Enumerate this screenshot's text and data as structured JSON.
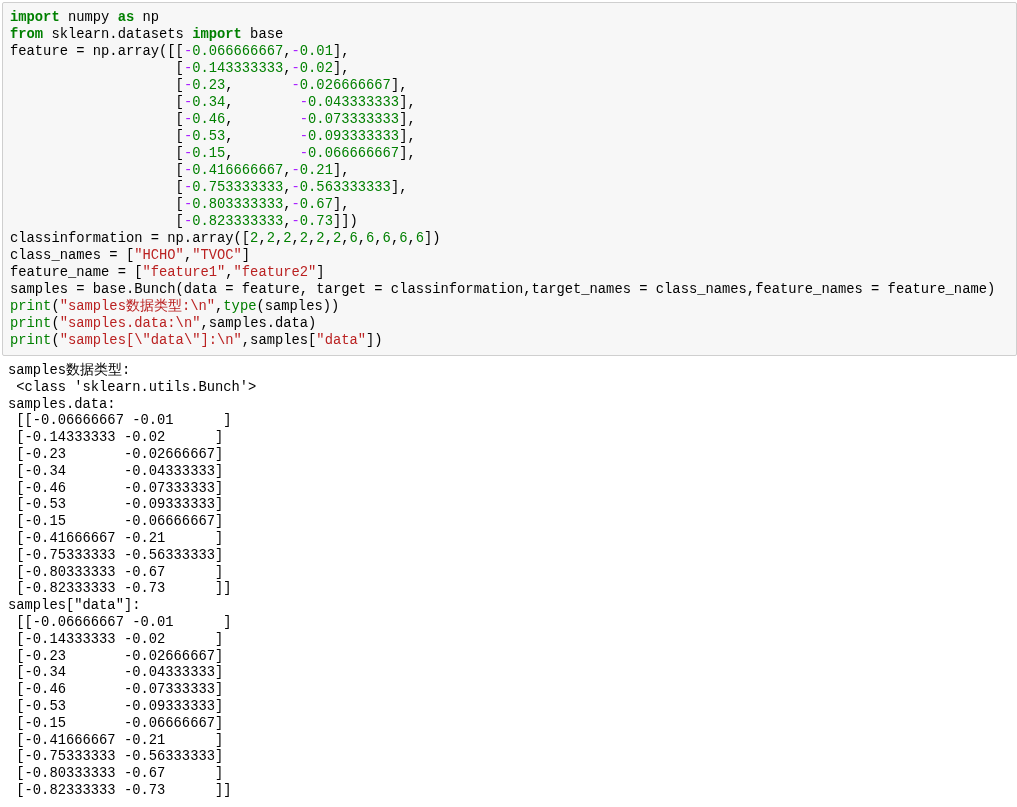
{
  "input_cell": {
    "lines": [
      [
        {
          "kind": "kw",
          "t": "import"
        },
        {
          "kind": "p",
          "t": " numpy "
        },
        {
          "kind": "kw",
          "t": "as"
        },
        {
          "kind": "p",
          "t": " np"
        }
      ],
      [
        {
          "kind": "kw",
          "t": "from"
        },
        {
          "kind": "p",
          "t": " sklearn.datasets "
        },
        {
          "kind": "kw",
          "t": "import"
        },
        {
          "kind": "p",
          "t": " base"
        }
      ],
      [
        {
          "kind": "p",
          "t": "feature = np.array([["
        },
        {
          "kind": "op",
          "t": "-"
        },
        {
          "kind": "num",
          "t": "0.066666667"
        },
        {
          "kind": "p",
          "t": ","
        },
        {
          "kind": "op",
          "t": "-"
        },
        {
          "kind": "num",
          "t": "0.01"
        },
        {
          "kind": "p",
          "t": "],"
        }
      ],
      [
        {
          "kind": "p",
          "t": "                    ["
        },
        {
          "kind": "op",
          "t": "-"
        },
        {
          "kind": "num",
          "t": "0.143333333"
        },
        {
          "kind": "p",
          "t": ","
        },
        {
          "kind": "op",
          "t": "-"
        },
        {
          "kind": "num",
          "t": "0.02"
        },
        {
          "kind": "p",
          "t": "],"
        }
      ],
      [
        {
          "kind": "p",
          "t": "                    ["
        },
        {
          "kind": "op",
          "t": "-"
        },
        {
          "kind": "num",
          "t": "0.23"
        },
        {
          "kind": "p",
          "t": ",       "
        },
        {
          "kind": "op",
          "t": "-"
        },
        {
          "kind": "num",
          "t": "0.026666667"
        },
        {
          "kind": "p",
          "t": "],"
        }
      ],
      [
        {
          "kind": "p",
          "t": "                    ["
        },
        {
          "kind": "op",
          "t": "-"
        },
        {
          "kind": "num",
          "t": "0.34"
        },
        {
          "kind": "p",
          "t": ",        "
        },
        {
          "kind": "op",
          "t": "-"
        },
        {
          "kind": "num",
          "t": "0.043333333"
        },
        {
          "kind": "p",
          "t": "],"
        }
      ],
      [
        {
          "kind": "p",
          "t": "                    ["
        },
        {
          "kind": "op",
          "t": "-"
        },
        {
          "kind": "num",
          "t": "0.46"
        },
        {
          "kind": "p",
          "t": ",        "
        },
        {
          "kind": "op",
          "t": "-"
        },
        {
          "kind": "num",
          "t": "0.073333333"
        },
        {
          "kind": "p",
          "t": "],"
        }
      ],
      [
        {
          "kind": "p",
          "t": "                    ["
        },
        {
          "kind": "op",
          "t": "-"
        },
        {
          "kind": "num",
          "t": "0.53"
        },
        {
          "kind": "p",
          "t": ",        "
        },
        {
          "kind": "op",
          "t": "-"
        },
        {
          "kind": "num",
          "t": "0.093333333"
        },
        {
          "kind": "p",
          "t": "],"
        }
      ],
      [
        {
          "kind": "p",
          "t": "                    ["
        },
        {
          "kind": "op",
          "t": "-"
        },
        {
          "kind": "num",
          "t": "0.15"
        },
        {
          "kind": "p",
          "t": ",        "
        },
        {
          "kind": "op",
          "t": "-"
        },
        {
          "kind": "num",
          "t": "0.066666667"
        },
        {
          "kind": "p",
          "t": "],"
        }
      ],
      [
        {
          "kind": "p",
          "t": "                    ["
        },
        {
          "kind": "op",
          "t": "-"
        },
        {
          "kind": "num",
          "t": "0.416666667"
        },
        {
          "kind": "p",
          "t": ","
        },
        {
          "kind": "op",
          "t": "-"
        },
        {
          "kind": "num",
          "t": "0.21"
        },
        {
          "kind": "p",
          "t": "],"
        }
      ],
      [
        {
          "kind": "p",
          "t": "                    ["
        },
        {
          "kind": "op",
          "t": "-"
        },
        {
          "kind": "num",
          "t": "0.753333333"
        },
        {
          "kind": "p",
          "t": ","
        },
        {
          "kind": "op",
          "t": "-"
        },
        {
          "kind": "num",
          "t": "0.563333333"
        },
        {
          "kind": "p",
          "t": "],"
        }
      ],
      [
        {
          "kind": "p",
          "t": "                    ["
        },
        {
          "kind": "op",
          "t": "-"
        },
        {
          "kind": "num",
          "t": "0.803333333"
        },
        {
          "kind": "p",
          "t": ","
        },
        {
          "kind": "op",
          "t": "-"
        },
        {
          "kind": "num",
          "t": "0.67"
        },
        {
          "kind": "p",
          "t": "],"
        }
      ],
      [
        {
          "kind": "p",
          "t": "                    ["
        },
        {
          "kind": "op",
          "t": "-"
        },
        {
          "kind": "num",
          "t": "0.823333333"
        },
        {
          "kind": "p",
          "t": ","
        },
        {
          "kind": "op",
          "t": "-"
        },
        {
          "kind": "num",
          "t": "0.73"
        },
        {
          "kind": "p",
          "t": "]])"
        }
      ],
      [
        {
          "kind": "p",
          "t": "classinformation = np.array(["
        },
        {
          "kind": "num",
          "t": "2"
        },
        {
          "kind": "p",
          "t": ","
        },
        {
          "kind": "num",
          "t": "2"
        },
        {
          "kind": "p",
          "t": ","
        },
        {
          "kind": "num",
          "t": "2"
        },
        {
          "kind": "p",
          "t": ","
        },
        {
          "kind": "num",
          "t": "2"
        },
        {
          "kind": "p",
          "t": ","
        },
        {
          "kind": "num",
          "t": "2"
        },
        {
          "kind": "p",
          "t": ","
        },
        {
          "kind": "num",
          "t": "2"
        },
        {
          "kind": "p",
          "t": ","
        },
        {
          "kind": "num",
          "t": "6"
        },
        {
          "kind": "p",
          "t": ","
        },
        {
          "kind": "num",
          "t": "6"
        },
        {
          "kind": "p",
          "t": ","
        },
        {
          "kind": "num",
          "t": "6"
        },
        {
          "kind": "p",
          "t": ","
        },
        {
          "kind": "num",
          "t": "6"
        },
        {
          "kind": "p",
          "t": ","
        },
        {
          "kind": "num",
          "t": "6"
        },
        {
          "kind": "p",
          "t": "])"
        }
      ],
      [
        {
          "kind": "p",
          "t": "class_names = ["
        },
        {
          "kind": "strc",
          "t": "\"HCHO\","
        },
        {
          "kind": "str",
          "t": "\"TVOC\""
        },
        {
          "kind": "p",
          "t": "]"
        }
      ],
      [
        {
          "kind": "p",
          "t": "feature_name = ["
        },
        {
          "kind": "strc",
          "t": "\"feature1\","
        },
        {
          "kind": "str",
          "t": "\"feature2\""
        },
        {
          "kind": "p",
          "t": "]"
        }
      ],
      [
        {
          "kind": "p",
          "t": "samples = base.Bunch(data = feature, target = classinformation,target_names = class_names,feature_names = feature_name)"
        }
      ],
      [
        {
          "kind": "bi",
          "t": "print"
        },
        {
          "kind": "p",
          "t": "("
        },
        {
          "kind": "str",
          "t": "\"samples数据类型:\\n\""
        },
        {
          "kind": "p",
          "t": ","
        },
        {
          "kind": "bi",
          "t": "type"
        },
        {
          "kind": "p",
          "t": "(samples))"
        }
      ],
      [
        {
          "kind": "bi",
          "t": "print"
        },
        {
          "kind": "p",
          "t": "("
        },
        {
          "kind": "str",
          "t": "\"samples.data:\\n\""
        },
        {
          "kind": "p",
          "t": ",samples.data)"
        }
      ],
      [
        {
          "kind": "bi",
          "t": "print"
        },
        {
          "kind": "p",
          "t": "("
        },
        {
          "kind": "str",
          "t": "\"samples[\\\"data\\\"]:\\n\""
        },
        {
          "kind": "p",
          "t": ",samples["
        },
        {
          "kind": "str",
          "t": "\"data\""
        },
        {
          "kind": "p",
          "t": "])"
        }
      ]
    ]
  },
  "output": [
    "samples数据类型:",
    " <class 'sklearn.utils.Bunch'>",
    "samples.data:",
    " [[-0.06666667 -0.01      ]",
    " [-0.14333333 -0.02      ]",
    " [-0.23       -0.02666667]",
    " [-0.34       -0.04333333]",
    " [-0.46       -0.07333333]",
    " [-0.53       -0.09333333]",
    " [-0.15       -0.06666667]",
    " [-0.41666667 -0.21      ]",
    " [-0.75333333 -0.56333333]",
    " [-0.80333333 -0.67      ]",
    " [-0.82333333 -0.73      ]]",
    "samples[\"data\"]:",
    " [[-0.06666667 -0.01      ]",
    " [-0.14333333 -0.02      ]",
    " [-0.23       -0.02666667]",
    " [-0.34       -0.04333333]",
    " [-0.46       -0.07333333]",
    " [-0.53       -0.09333333]",
    " [-0.15       -0.06666667]",
    " [-0.41666667 -0.21      ]",
    " [-0.75333333 -0.56333333]",
    " [-0.80333333 -0.67      ]",
    " [-0.82333333 -0.73      ]]"
  ]
}
